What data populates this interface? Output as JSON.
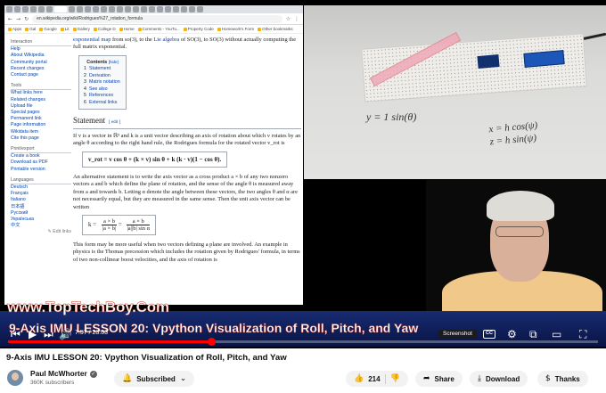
{
  "browser": {
    "url": "en.wikipedia.org/wiki/Rodrigues%27_rotation_formula",
    "bookmarks": [
      "Apps",
      "Gal",
      "Google",
      "Lit",
      "Gallery",
      "College D",
      "Home",
      "Comments - YouTu...",
      "Property Code",
      "Homework's Form",
      "Other bookmarks"
    ]
  },
  "wiki": {
    "sidebar": {
      "interaction_heading": "Interaction",
      "interaction": [
        "Help",
        "About Wikipedia",
        "Community portal",
        "Recent changes",
        "Contact page"
      ],
      "tools_heading": "Tools",
      "tools": [
        "What links here",
        "Related changes",
        "Upload file",
        "Special pages",
        "Permanent link",
        "Page information",
        "Wikidata item",
        "Cite this page"
      ],
      "print_heading": "Print/export",
      "print": [
        "Create a book",
        "Download as PDF",
        "Printable version"
      ],
      "languages_heading": "Languages",
      "languages": [
        "Deutsch",
        "Français",
        "Italiano",
        "日本語",
        "Русский",
        "Українська",
        "中文"
      ],
      "edit_links": "✎ Edit links"
    },
    "intro": {
      "link1": "exponential map",
      "text1": " from so(3), to SO(3) without actually computing",
      "link2": "Lie algebra",
      "text0": " of SO(3), to SO(3) without actually computing the full matrix exponential."
    },
    "toc": {
      "title": "Contents",
      "hide": "[hide]",
      "items": [
        {
          "num": "1",
          "label": "Statement"
        },
        {
          "num": "2",
          "label": "Derivation"
        },
        {
          "num": "3",
          "label": "Matrix notation"
        },
        {
          "num": "4",
          "label": "See also"
        },
        {
          "num": "5",
          "label": "References"
        },
        {
          "num": "6",
          "label": "External links"
        }
      ]
    },
    "statement": {
      "heading": "Statement",
      "edit": "[ edit ]",
      "para1": "If v is a vector in ℝ³ and k is a unit vector describing an axis of rotation about which v rotates by an angle θ according to the right hand rule, the Rodrigues formula for the rotated vector v_rot is",
      "formula": "v_rot = v cos θ + (k × v) sin θ + k (k · v)(1 − cos θ).",
      "para2": "An alternative statement is to write the axis vector as a cross product a × b of any two nonzero vectors a and b which define the plane of rotation, and the sense of the angle θ is measured away from a and towards b. Letting α denote the angle between these vectors, the two angles θ and α are not necessarily equal, but they are measured in the same sense. Then the unit axis vector can be written",
      "formula2_lhs": "k =",
      "formula2_num1": "a × b",
      "formula2_den1": "|a × b|",
      "formula2_num2": "a × b",
      "formula2_den2": "|a||b| sin α",
      "para3": "This form may be more useful when two vectors defining a plane are involved. An example in physics is the Thomas precession which includes the rotation given by Rodrigues' formula, in terms of two non-collinear boost velocities, and the axis of rotation is"
    }
  },
  "whiteboard": {
    "y_eq": "y = 1 sin(θ)",
    "x_eq": "x = h cos(ψ)",
    "z_eq": "z = h sin(ψ)"
  },
  "player": {
    "watermark": "www.TopTechBoy.Com",
    "overlay_title": "9-Axis IMU LESSON 20: Vpython Visualization of Roll, Pitch, and Yaw",
    "time": "7:57 / 23:03",
    "progress_fraction": 0.345,
    "tooltip": "Screenshot",
    "cc_label": "CC"
  },
  "video": {
    "title": "9-Axis IMU LESSON 20: Vpython Visualization of Roll, Pitch, and Yaw",
    "channel": "Paul McWhorter",
    "subscribers": "360K subscribers",
    "subscribe_label": "Subscribed",
    "likes": "214",
    "share_label": "Share",
    "download_label": "Download",
    "thanks_label": "Thanks",
    "more_label": "..."
  }
}
